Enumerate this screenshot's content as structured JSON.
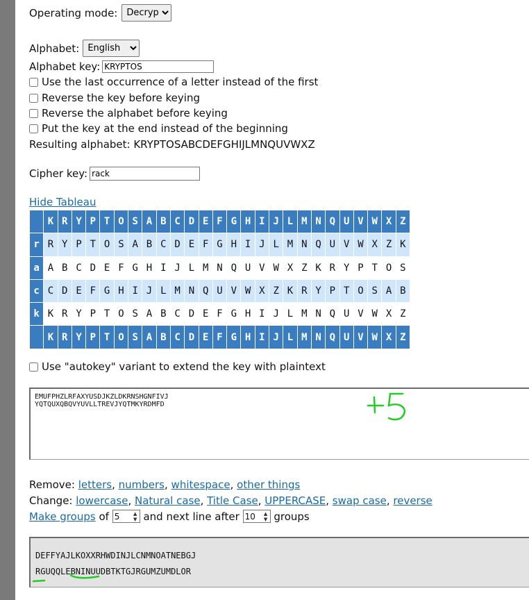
{
  "operating_mode": {
    "label": "Operating mode:",
    "value": "Decrypt"
  },
  "alphabet": {
    "label": "Alphabet:",
    "value": "English"
  },
  "alphabet_key": {
    "label": "Alphabet key:",
    "value": "KRYPTOS"
  },
  "options": [
    "Use the last occurrence of a letter instead of the first",
    "Reverse the key before keying",
    "Reverse the alphabet before keying",
    "Put the key at the end instead of the beginning"
  ],
  "resulting_alphabet": "Resulting alphabet: KRYPTOSABCDEFGHIJLMNQUVWXZ",
  "cipher_key": {
    "label": "Cipher key:",
    "value": "rack"
  },
  "hide_tableau": "Hide Tableau",
  "tableau": {
    "header": [
      "K",
      "R",
      "Y",
      "P",
      "T",
      "O",
      "S",
      "A",
      "B",
      "C",
      "D",
      "E",
      "F",
      "G",
      "H",
      "I",
      "J",
      "L",
      "M",
      "N",
      "Q",
      "U",
      "V",
      "W",
      "X",
      "Z"
    ],
    "rows": [
      {
        "key": "r",
        "letters": [
          "R",
          "Y",
          "P",
          "T",
          "O",
          "S",
          "A",
          "B",
          "C",
          "D",
          "E",
          "F",
          "G",
          "H",
          "I",
          "J",
          "L",
          "M",
          "N",
          "Q",
          "U",
          "V",
          "W",
          "X",
          "Z",
          "K"
        ]
      },
      {
        "key": "a",
        "letters": [
          "A",
          "B",
          "C",
          "D",
          "E",
          "F",
          "G",
          "H",
          "I",
          "J",
          "L",
          "M",
          "N",
          "Q",
          "U",
          "V",
          "W",
          "X",
          "Z",
          "K",
          "R",
          "Y",
          "P",
          "T",
          "O",
          "S"
        ]
      },
      {
        "key": "c",
        "letters": [
          "C",
          "D",
          "E",
          "F",
          "G",
          "H",
          "I",
          "J",
          "L",
          "M",
          "N",
          "Q",
          "U",
          "V",
          "W",
          "X",
          "Z",
          "K",
          "R",
          "Y",
          "P",
          "T",
          "O",
          "S",
          "A",
          "B"
        ]
      },
      {
        "key": "k",
        "letters": [
          "K",
          "R",
          "Y",
          "P",
          "T",
          "O",
          "S",
          "A",
          "B",
          "C",
          "D",
          "E",
          "F",
          "G",
          "H",
          "I",
          "J",
          "L",
          "M",
          "N",
          "Q",
          "U",
          "V",
          "W",
          "X",
          "Z"
        ]
      }
    ]
  },
  "autokey_label": "Use \"autokey\" variant to extend the key with plaintext",
  "input_text": [
    "EMUFPHZLRFAXYUSDJKZLDKRNSHGNFIVJ",
    "YQTQUXQBQVYUVLLTREVJYQTMKYRDMFD"
  ],
  "annotation": "+5",
  "remove": {
    "label": "Remove:",
    "links": [
      "letters",
      "numbers",
      "whitespace",
      "other things"
    ]
  },
  "change": {
    "label": "Change:",
    "links": [
      "lowercase",
      "Natural case",
      "Title Case",
      "UPPERCASE",
      "swap case",
      "reverse"
    ]
  },
  "groups": {
    "link": "Make groups",
    "of": "of",
    "size": "5",
    "mid": "and next line after",
    "lines": "10",
    "tail": "groups"
  },
  "output_text": [
    "DEFFYAJLKOXXRHWDINJLCNMNOATNEBGJ",
    "RGUQQLEBNINUUDBTKTGJRGUMZUMDLOR"
  ],
  "colors": {
    "header_blue": "#3a7cc0",
    "row_light_blue": "#d0e6fb",
    "link": "#1a6aa8",
    "annotation_green": "#22cc22"
  }
}
